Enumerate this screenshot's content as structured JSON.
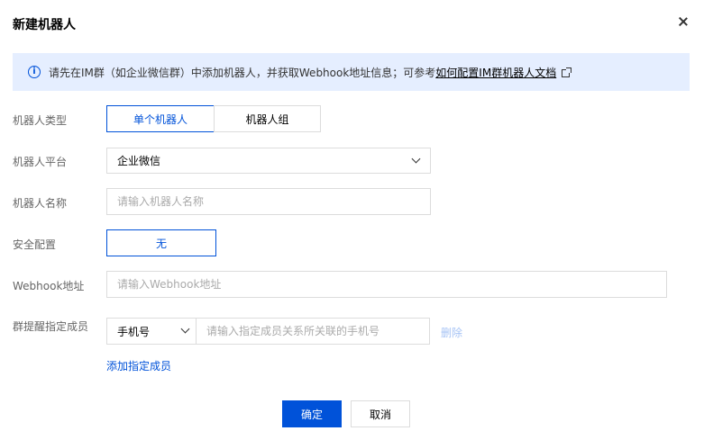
{
  "dialog": {
    "title": "新建机器人"
  },
  "notice": {
    "text": "请先在IM群（如企业微信群）中添加机器人，并获取Webhook地址信息；可参考",
    "link": "如何配置IM群机器人文档"
  },
  "form": {
    "robot_type": {
      "label": "机器人类型",
      "options": [
        "单个机器人",
        "机器人组"
      ],
      "selected": "单个机器人"
    },
    "platform": {
      "label": "机器人平台",
      "value": "企业微信"
    },
    "name": {
      "label": "机器人名称",
      "placeholder": "请输入机器人名称"
    },
    "security": {
      "label": "安全配置",
      "value": "无"
    },
    "webhook": {
      "label": "Webhook地址",
      "placeholder": "请输入Webhook地址"
    },
    "mention": {
      "label": "群提醒指定成员",
      "type_value": "手机号",
      "placeholder": "请输入指定成员关系所关联的手机号",
      "delete_label": "删除",
      "add_label": "添加指定成员"
    }
  },
  "footer": {
    "ok_label": "确定",
    "cancel_label": "取消"
  },
  "colors": {
    "primary": "#0052d9",
    "notice_bg": "#e5eeff",
    "disabled_link": "#a6c3f5",
    "border": "#dcdcdc"
  }
}
